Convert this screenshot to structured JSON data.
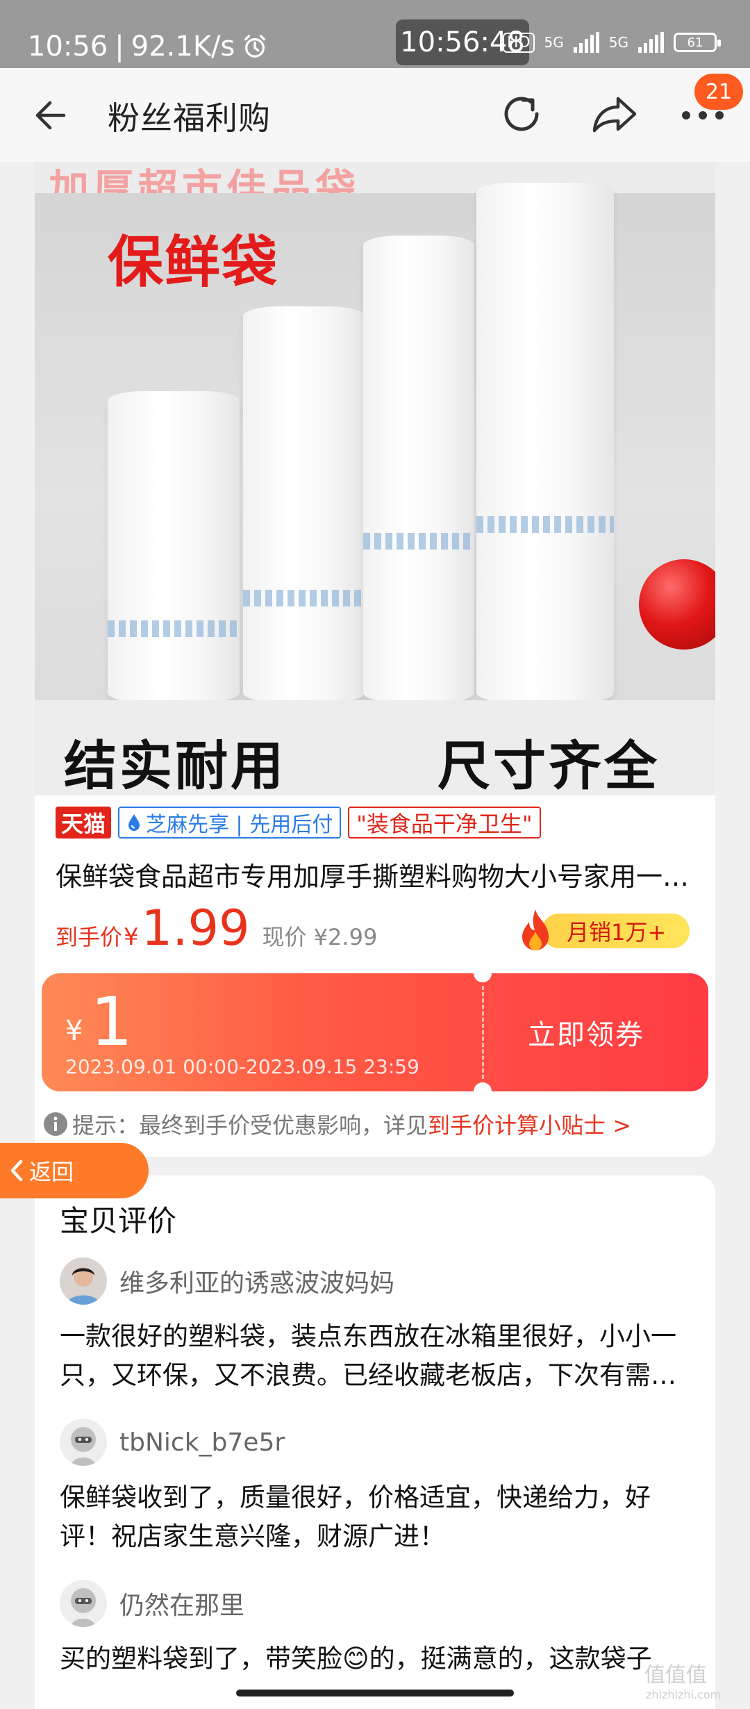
{
  "status_bar": {
    "time": "10:56",
    "network_speed": "92.1K/s",
    "clock_pill": "10:56:48",
    "hd_label": "HD",
    "sim1": "5G",
    "sim2": "5G",
    "battery": "61"
  },
  "nav": {
    "title": "粉丝福利购",
    "badge_count": "21"
  },
  "product": {
    "image": {
      "top_faded_text": "加厚超市佳品袋",
      "headline": "保鲜袋",
      "slogan_left": "结实耐用",
      "slogan_right": "尺寸齐全"
    },
    "tags": {
      "tmall": "天猫",
      "zhima": "芝麻先享 | 先用后付",
      "quote": "\"装食品干净卫生\""
    },
    "title": "保鲜袋食品超市专用加厚手撕塑料购物大小号家用一次性背心袋",
    "price_label": "到手价",
    "currency": "¥",
    "price": "1.99",
    "original_price": "现价 ¥2.99",
    "monthly_sales": "月销1万+"
  },
  "coupon": {
    "currency": "¥",
    "amount": "1",
    "period": "2023.09.01 00:00-2023.09.15 23:59",
    "claim_label": "立即领券"
  },
  "tip": {
    "text": "提示：最终到手价受优惠影响，详见",
    "link": "到手价计算小贴士 >"
  },
  "float_back": {
    "label": "返回"
  },
  "reviews": {
    "title": "宝贝评价",
    "items": [
      {
        "user": "维多利亚的诱惑波波妈妈",
        "text": "一款很好的塑料袋，装点东西放在冰箱里很好，小小一只，又环保，又不浪费。已经收藏老板店，下次有需要还会再来。"
      },
      {
        "user": "tbNick_b7e5r",
        "text": "保鲜袋收到了，质量很好，价格适宜，快递给力，好评！祝店家生意兴隆，财源广进！"
      },
      {
        "user": "仍然在那里",
        "text": "买的塑料袋到了，带笑脸😊的，挺满意的，这款袋子"
      }
    ]
  },
  "watermark": {
    "text": "值值值",
    "sub": "zhizhizhi.com"
  },
  "colors": {
    "accent": "#e8331c",
    "coupon_start": "#ff8a57",
    "coupon_end": "#ff3b44",
    "float_back": "#ff7a29",
    "tmall_red": "#e1251b",
    "zhima_blue": "#2a7be4"
  }
}
